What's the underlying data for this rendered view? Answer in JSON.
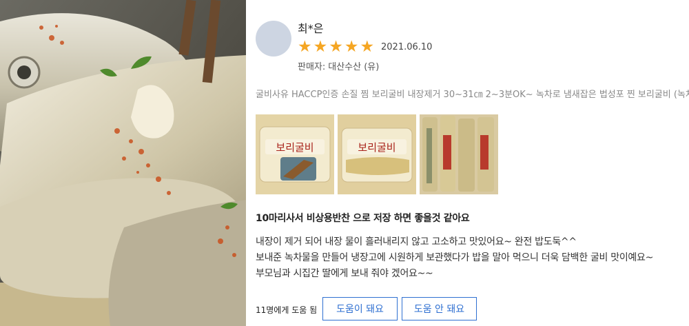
{
  "review": {
    "author": "최*은",
    "rating": 5,
    "rating_max": 5,
    "star_color": "#f5a623",
    "date": "2021.06.10",
    "seller_label": "판매자:",
    "seller_value": "대산수산 (유)",
    "product": "굴비사유 HACCP인증 손질 찜 보리굴비 내장제거 30~31㎝ 2~3분OK~ 녹차로 냄새잡은 법성포 찐 보리굴비 (녹차증",
    "thumbnails": [
      {
        "label": "보리굴비"
      },
      {
        "label": "보리굴비"
      },
      {
        "label": ""
      }
    ],
    "headline": "10마리사서 비상용반찬 으로 저장 하면 좋을것 같아요",
    "body_lines": [
      "내장이 제거 되어 내장 물이 흘러내리지 않고 고소하고 맛있어요~ 완전 밥도둑^^",
      "보내준 녹차물을 만들어 냉장고에 시원하게 보관했다가 밥을 말아 먹으니 더욱 담백한 굴비 맛이예요~",
      "부모님과 시집간 딸에게 보내 줘야 겠어요~~"
    ],
    "helpful_count_text": "11명에게 도움 됨",
    "helpful_yes": "도움이 돼요",
    "helpful_no": "도움 안 돼요",
    "accent_color": "#2e6fd1"
  }
}
